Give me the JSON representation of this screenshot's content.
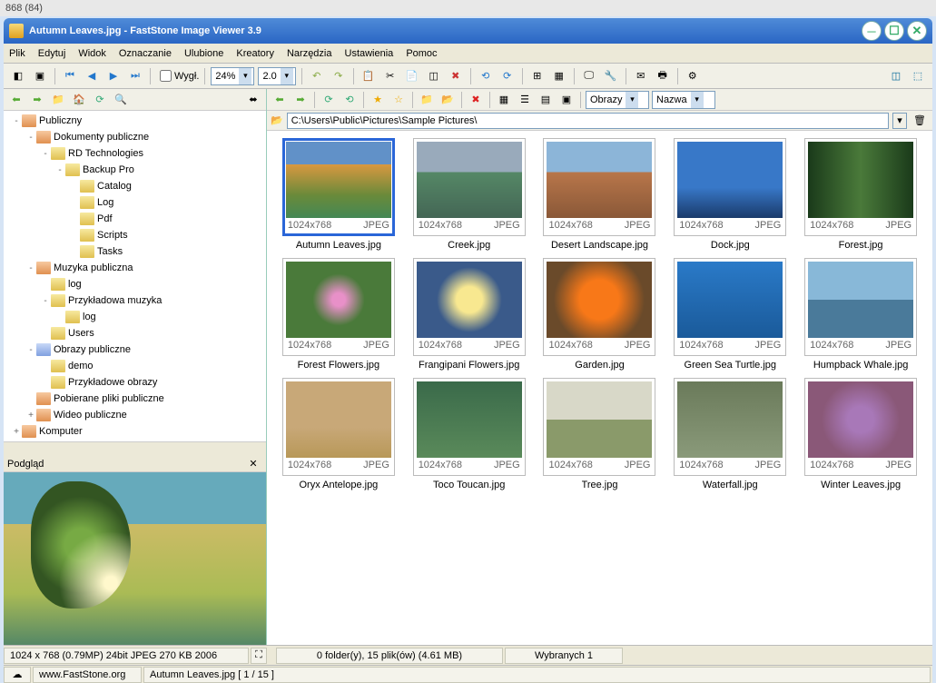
{
  "topInfo": "868 (84)",
  "title": "Autumn Leaves.jpg  -  FastStone Image Viewer 3.9",
  "menu": [
    "Plik",
    "Edytuj",
    "Widok",
    "Oznaczanie",
    "Ulubione",
    "Kreatory",
    "Narzędzia",
    "Ustawienia",
    "Pomoc"
  ],
  "toolbar": {
    "viewCheck": "Wygł.",
    "zoom": "24%",
    "scale": "2.0"
  },
  "thumbToolbar": {
    "filterLabel": "Obrazy",
    "sortLabel": "Nazwa"
  },
  "path": "C:\\Users\\Public\\Pictures\\Sample Pictures\\",
  "tree": [
    {
      "d": 0,
      "exp": "-",
      "label": "Publiczny",
      "cls": "special"
    },
    {
      "d": 1,
      "exp": "-",
      "label": "Dokumenty publiczne",
      "cls": "special"
    },
    {
      "d": 2,
      "exp": "-",
      "label": "RD Technologies",
      "cls": ""
    },
    {
      "d": 3,
      "exp": "-",
      "label": "Backup Pro",
      "cls": ""
    },
    {
      "d": 4,
      "exp": "",
      "label": "Catalog",
      "cls": ""
    },
    {
      "d": 4,
      "exp": "",
      "label": "Log",
      "cls": ""
    },
    {
      "d": 4,
      "exp": "",
      "label": "Pdf",
      "cls": ""
    },
    {
      "d": 4,
      "exp": "",
      "label": "Scripts",
      "cls": ""
    },
    {
      "d": 4,
      "exp": "",
      "label": "Tasks",
      "cls": ""
    },
    {
      "d": 1,
      "exp": "-",
      "label": "Muzyka publiczna",
      "cls": "special"
    },
    {
      "d": 2,
      "exp": "",
      "label": "log",
      "cls": ""
    },
    {
      "d": 2,
      "exp": "-",
      "label": "Przykładowa muzyka",
      "cls": ""
    },
    {
      "d": 3,
      "exp": "",
      "label": "log",
      "cls": ""
    },
    {
      "d": 2,
      "exp": "",
      "label": "Users",
      "cls": ""
    },
    {
      "d": 1,
      "exp": "-",
      "label": "Obrazy publiczne",
      "cls": "img"
    },
    {
      "d": 2,
      "exp": "",
      "label": "demo",
      "cls": ""
    },
    {
      "d": 2,
      "exp": "",
      "label": "Przykładowe obrazy",
      "cls": ""
    },
    {
      "d": 1,
      "exp": "",
      "label": "Pobierane pliki publiczne",
      "cls": "special"
    },
    {
      "d": 1,
      "exp": "+",
      "label": "Wideo publiczne",
      "cls": "special"
    },
    {
      "d": 0,
      "exp": "+",
      "label": "Komputer",
      "cls": "special"
    }
  ],
  "previewLabel": "Podgląd",
  "thumbs": [
    {
      "name": "Autumn Leaves.jpg",
      "dim": "1024x768",
      "fmt": "JPEG",
      "sel": true,
      "bg": "bg-autumn"
    },
    {
      "name": "Creek.jpg",
      "dim": "1024x768",
      "fmt": "JPEG",
      "sel": false,
      "bg": "bg-creek"
    },
    {
      "name": "Desert Landscape.jpg",
      "dim": "1024x768",
      "fmt": "JPEG",
      "sel": false,
      "bg": "bg-desert"
    },
    {
      "name": "Dock.jpg",
      "dim": "1024x768",
      "fmt": "JPEG",
      "sel": false,
      "bg": "bg-dock"
    },
    {
      "name": "Forest.jpg",
      "dim": "1024x768",
      "fmt": "JPEG",
      "sel": false,
      "bg": "bg-forest"
    },
    {
      "name": "Forest Flowers.jpg",
      "dim": "1024x768",
      "fmt": "JPEG",
      "sel": false,
      "bg": "bg-forestfl"
    },
    {
      "name": "Frangipani Flowers.jpg",
      "dim": "1024x768",
      "fmt": "JPEG",
      "sel": false,
      "bg": "bg-frangipani"
    },
    {
      "name": "Garden.jpg",
      "dim": "1024x768",
      "fmt": "JPEG",
      "sel": false,
      "bg": "bg-garden"
    },
    {
      "name": "Green Sea Turtle.jpg",
      "dim": "1024x768",
      "fmt": "JPEG",
      "sel": false,
      "bg": "bg-turtle"
    },
    {
      "name": "Humpback Whale.jpg",
      "dim": "1024x768",
      "fmt": "JPEG",
      "sel": false,
      "bg": "bg-whale"
    },
    {
      "name": "Oryx Antelope.jpg",
      "dim": "1024x768",
      "fmt": "JPEG",
      "sel": false,
      "bg": "bg-oryx"
    },
    {
      "name": "Toco Toucan.jpg",
      "dim": "1024x768",
      "fmt": "JPEG",
      "sel": false,
      "bg": "bg-toucan"
    },
    {
      "name": "Tree.jpg",
      "dim": "1024x768",
      "fmt": "JPEG",
      "sel": false,
      "bg": "bg-tree"
    },
    {
      "name": "Waterfall.jpg",
      "dim": "1024x768",
      "fmt": "JPEG",
      "sel": false,
      "bg": "bg-waterfall"
    },
    {
      "name": "Winter Leaves.jpg",
      "dim": "1024x768",
      "fmt": "JPEG",
      "sel": false,
      "bg": "bg-winter"
    }
  ],
  "status": {
    "imgInfo": "1024 x 768 (0.79MP)  24bit JPEG  270 KB   2006",
    "folderInfo": "0 folder(y), 15 plik(ów) (4.61 MB)",
    "selInfo": "Wybranych 1",
    "site": "www.FastStone.org",
    "current": "Autumn Leaves.jpg [ 1 / 15 ]"
  }
}
